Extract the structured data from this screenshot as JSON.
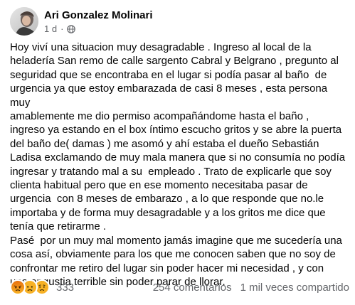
{
  "post": {
    "author": "Ari Gonzalez Molinari",
    "time": "1 d",
    "separator": "·",
    "privacy_icon": "globe-icon",
    "text": "Hoy viví una situacion muy desagradable . Ingreso al local de la\nheladería San remo de calle sargento Cabral y Belgrano , pregunto al\nseguridad que se encontraba en el lugar si podía pasar al baño  de\nurgencia ya que estoy embarazada de casi 8 meses , esta persona muy\namablemente me dio permiso acompañándome hasta el baño ,\ningreso ya estando en el box íntimo escucho gritos y se abre la puerta\ndel baño de( damas ) me asomó y ahí estaba el dueño Sebastián\nLadisa exclamando de muy mala manera que si no consumía no podía\ningresar y tratando mal a su  empleado . Trato de explicarle que soy\nclienta habitual pero que en ese momento necesitaba pasar de\nurgencia  con 8 meses de embarazo , a lo que responde que no.le\nimportaba y de forma muy desagradable y a los gritos me dice que\ntenía que retirarme .\nPasé  por un muy mal momento jamás imagine que me sucedería una\ncosa así, obviamente para los que me conocen saben que no soy de\nconfrontar me retiro del lugar sin poder hacer mi necesidad , y con\nuna angustia terrible sin poder parar de llorar."
  },
  "reactions": {
    "icons": [
      "angry-reaction-icon",
      "sad-reaction-icon",
      "sad-reaction-icon-2"
    ],
    "count": "333"
  },
  "stats": {
    "comments": "254 comentarios",
    "shares": "1 mil veces compartido"
  },
  "colors": {
    "text": "#050505",
    "secondary": "#65676b",
    "angry": "#e9710f",
    "sad": "#f7b125"
  }
}
